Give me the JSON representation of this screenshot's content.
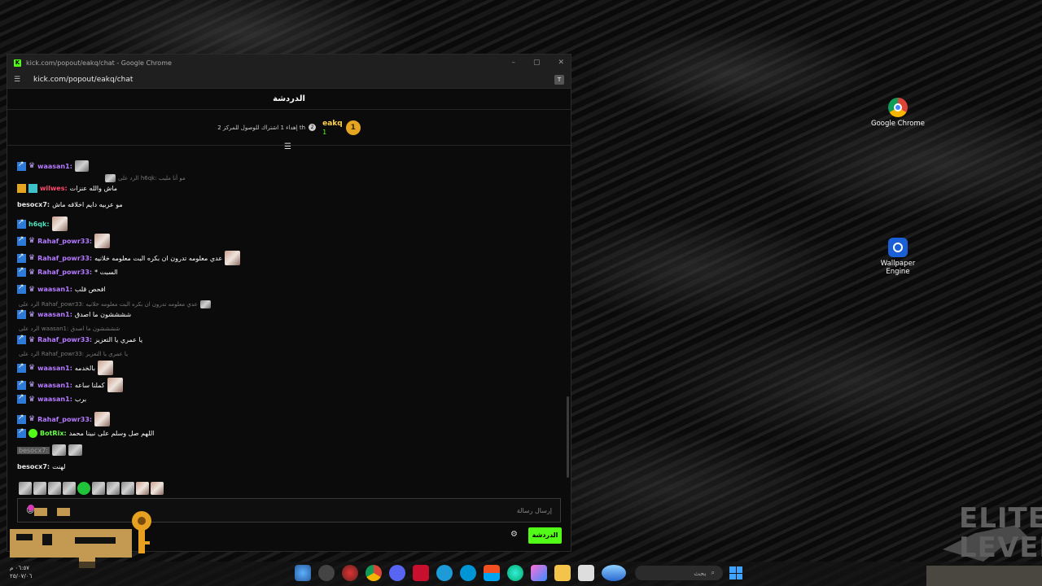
{
  "window": {
    "title": "kick.com/popout/eakq/chat - Google Chrome",
    "url": "kick.com/popout/eakq/chat",
    "controls": [
      "–",
      "▢",
      "✕"
    ]
  },
  "chat": {
    "header": "الدردشة",
    "pinned": {
      "rank": "1",
      "username": "eakq",
      "count": "1",
      "goal_number": "2",
      "goal_text": "إهداء 1 اشتراك للوصول للمركز 2 th"
    }
  },
  "messages": [
    {
      "user": "waasan1",
      "sep": ":",
      "text": ""
    },
    {
      "reply": "الرد على h6qk: مو أنا مليب"
    },
    {
      "user": "wilwes",
      "sep": ":",
      "text": "ماش والله عنزات"
    },
    {
      "user": "besocx7",
      "sep": ":",
      "text": "مو عربيه دايم اخلاقه ماش"
    },
    {
      "user": "h6qk",
      "sep": ":",
      "text": ""
    },
    {
      "user": "Rahaf_powr33",
      "sep": ":",
      "text": ""
    },
    {
      "user": "Rahaf_powr33",
      "sep": ":",
      "text": "عدي معلومه تدرون ان بكره البت معلومه خلانيه"
    },
    {
      "user": "Rahaf_powr33",
      "sep": ":",
      "text": "* السبت"
    },
    {
      "user": "waasan1",
      "sep": ":",
      "text": "افحص قلب"
    },
    {
      "reply": "الرد على Rahaf_powr33: عدي معلومه تدرون ان بكره البت معلومه خلانيه"
    },
    {
      "user": "waasan1",
      "sep": ":",
      "text": "ششششون ما اصدق"
    },
    {
      "reply": "الرد على waasan1: ششششون ما اصدق"
    },
    {
      "user": "Rahaf_powr33",
      "sep": ":",
      "text": "يا عمري يا التعزيز"
    },
    {
      "reply": "الرد على Rahaf_powr33: يا عمري يا التعزيز"
    },
    {
      "user": "waasan1",
      "sep": ":",
      "text": "بالخدمه"
    },
    {
      "user": "waasan1",
      "sep": ":",
      "text": "كملنا ساعه"
    },
    {
      "user": "waasan1",
      "sep": ":",
      "text": "برب"
    },
    {
      "user": "Rahaf_powr33",
      "sep": ":",
      "text": ""
    },
    {
      "user": "BotRix",
      "sep": ":",
      "text": "اللهم صل وسلم على نبينا محمد"
    },
    {
      "user": "besocx7",
      "sep": ":",
      "text": ""
    },
    {
      "user": "besocx7",
      "sep": ":",
      "text": "لهنت"
    }
  ],
  "input": {
    "placeholder": "إرسال رسالة",
    "send_label": "الدردشة"
  },
  "desktop": {
    "icon1": "Google Chrome",
    "icon2": "Wallpaper Engine"
  },
  "taskbar": {
    "search": "بحث",
    "time": "٠٦:٥٧ م",
    "date": "٢٥/٠٧/٠٦"
  },
  "logos": {
    "elite": "ELITE LEVEL"
  }
}
